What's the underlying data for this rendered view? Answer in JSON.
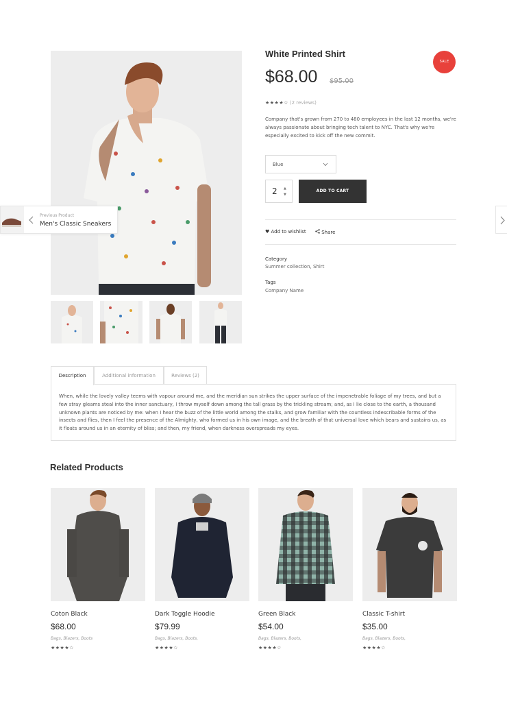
{
  "product": {
    "title": "White Printed Shirt",
    "sale_badge": "SALE",
    "price": "$68.00",
    "old_price": "$95.00",
    "rating_stars": "★★★★☆",
    "reviews_count": "(2 reviews)",
    "description": "Company that's grown from 270 to 480 employees in the last 12 months, we're always passionate about bringing tech talent to NYC. That's why we're especially excited to kick off the new commit.",
    "color_select": {
      "selected": "Blue"
    },
    "quantity": "2",
    "add_to_cart": "ADD TO CART",
    "wishlist_label": "Add to wishlist",
    "share_label": "Share",
    "category_label": "Category",
    "category_value": "Summer collection, Shirt",
    "tags_label": "Tags",
    "tags_value": "Company Name"
  },
  "prev_product": {
    "small_label": "Previous Product",
    "name": "Men's Classic Sneakers"
  },
  "tabs": [
    {
      "label": "Description"
    },
    {
      "label": "Additional information"
    },
    {
      "label": "Reviews (2)"
    }
  ],
  "tab_content": "When, while the lovely valley teems with vapour around me, and the meridian sun strikes the upper surface of the impenetrable foliage of my trees, and but a few stray gleams steal into the inner sanctuary, I throw myself down among the tall grass by the trickling stream; and, as I lie close to the earth, a thousand unknown plants are noticed by me: when I hear the buzz of the little world among the stalks, and grow familiar with the countless indescribable forms of the insects and flies, then I feel the presence of the Almighty, who formed us in his own image, and the breath of that universal love which bears and sustains us, as it floats around us in an eternity of bliss; and then, my friend, when darkness overspreads my eyes.",
  "related": {
    "title": "Related Products",
    "items": [
      {
        "name": "Coton Black",
        "price": "$68.00",
        "tags": "Bags, Blazers, Boots",
        "stars": "★★★★☆"
      },
      {
        "name": "Dark Toggle Hoodie",
        "price": "$79.99",
        "tags": "Bags, Blazers, Boots,",
        "stars": "★★★★☆"
      },
      {
        "name": "Green Black",
        "price": "$54.00",
        "tags": "Bags, Blazers, Boots,",
        "stars": "★★★★☆"
      },
      {
        "name": "Classic T-shirt",
        "price": "$35.00",
        "tags": "Bags, Blazers, Boots,",
        "stars": "★★★★☆"
      }
    ]
  },
  "colors": {
    "sale": "#e8413b",
    "button": "#333333",
    "image_bg": "#ededed"
  }
}
